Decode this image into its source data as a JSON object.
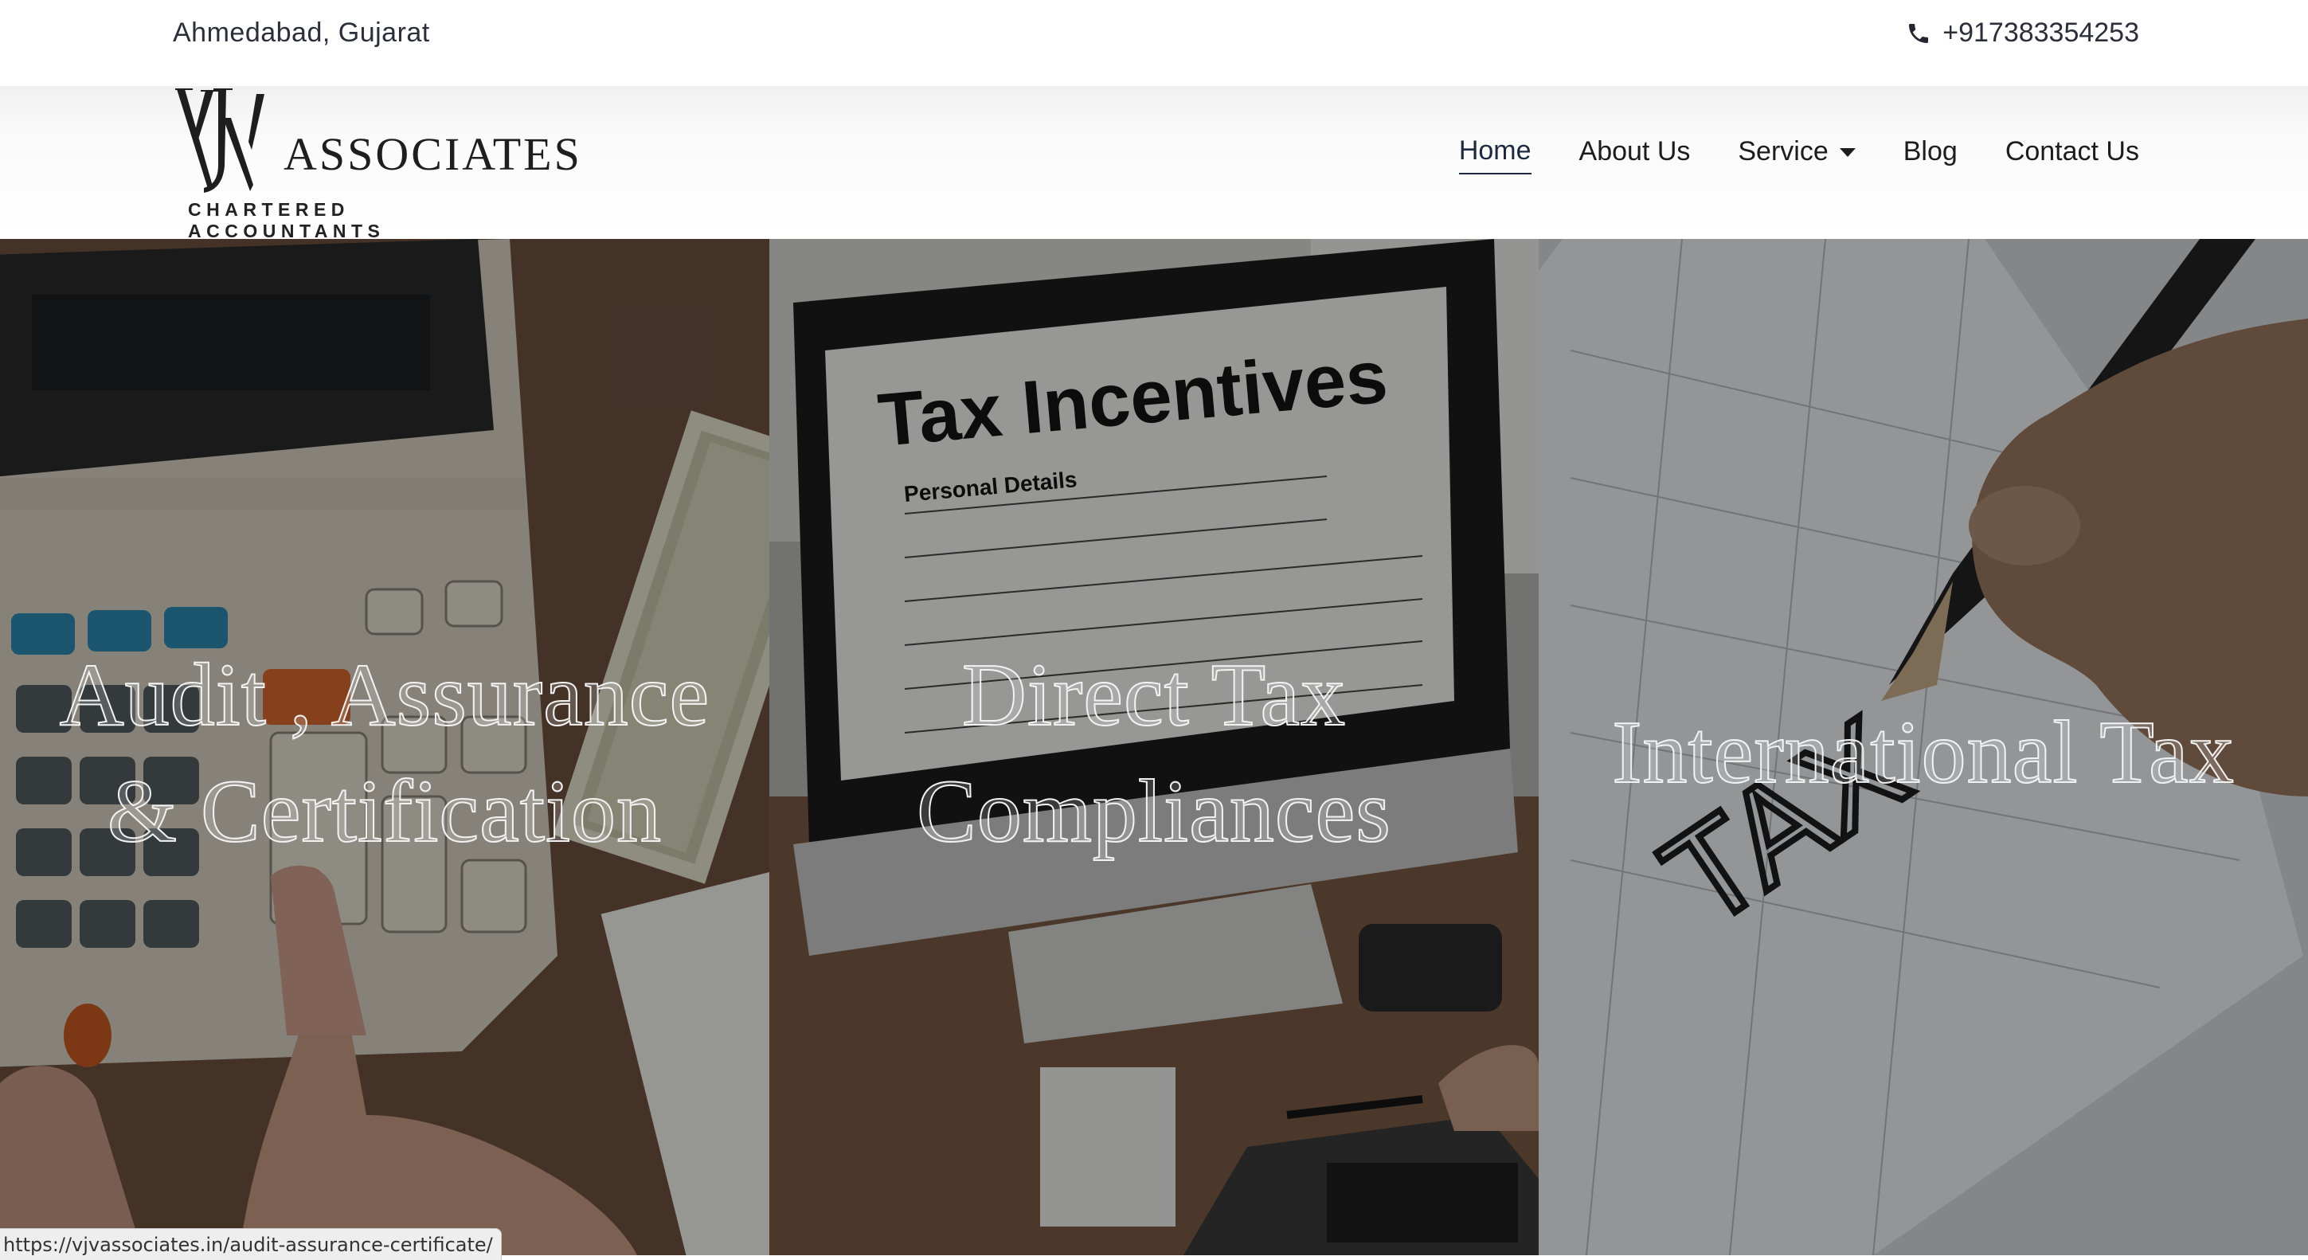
{
  "topbar": {
    "location": "Ahmedabad, Gujarat",
    "phone": "+917383354253",
    "phone_icon": "phone-icon"
  },
  "logo": {
    "wordmark": "ASSOCIATES",
    "tagline": "CHARTERED ACCOUNTANTS"
  },
  "nav": {
    "items": [
      {
        "label": "Home",
        "active": true
      },
      {
        "label": "About Us"
      },
      {
        "label": "Service",
        "has_dropdown": true
      },
      {
        "label": "Blog"
      },
      {
        "label": "Contact Us"
      }
    ]
  },
  "hero": {
    "panels": [
      {
        "title_line1": "Audit , Assurance",
        "title_line2": "& Certification"
      },
      {
        "title_line1": "Direct Tax",
        "title_line2": "Compliances"
      },
      {
        "title_line1": "International Tax"
      }
    ],
    "screen_heading": "Tax Incentives",
    "form_subheading": "Personal Details",
    "handwriting": "TAX"
  },
  "status_url": "https://vjvassociates.in/audit-assurance-certificate/"
}
